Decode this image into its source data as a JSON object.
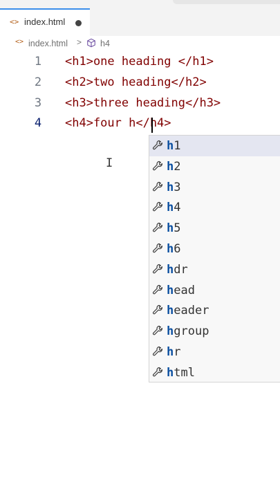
{
  "tab": {
    "icon": "<>",
    "label": "index.html"
  },
  "breadcrumb": {
    "file": "index.html",
    "separator": ">",
    "element": "h4"
  },
  "editor": {
    "lines": [
      {
        "number": "1",
        "code": "<h1>one heading </h1>"
      },
      {
        "number": "2",
        "code": "<h2>two heading</h2>"
      },
      {
        "number": "3",
        "code": "<h3>three heading</h3>"
      },
      {
        "number": "4",
        "code": "<h4>four h</h4>"
      }
    ],
    "active_line": "4"
  },
  "suggestions": {
    "typed": "h",
    "items": [
      "h1",
      "h2",
      "h3",
      "h4",
      "h5",
      "h6",
      "hdr",
      "head",
      "header",
      "hgroup",
      "hr",
      "html"
    ],
    "selected": "h1"
  },
  "colors": {
    "tag": "#800000",
    "match": "#0b4fa0",
    "selected_bg": "#e4e6f1",
    "modified_dot": "#444444",
    "tab_accent": "#3b8eea"
  },
  "icons": {
    "file_icon": "code-brackets-icon",
    "element_icon": "cube-icon",
    "suggestion_icon": "wrench-icon"
  }
}
